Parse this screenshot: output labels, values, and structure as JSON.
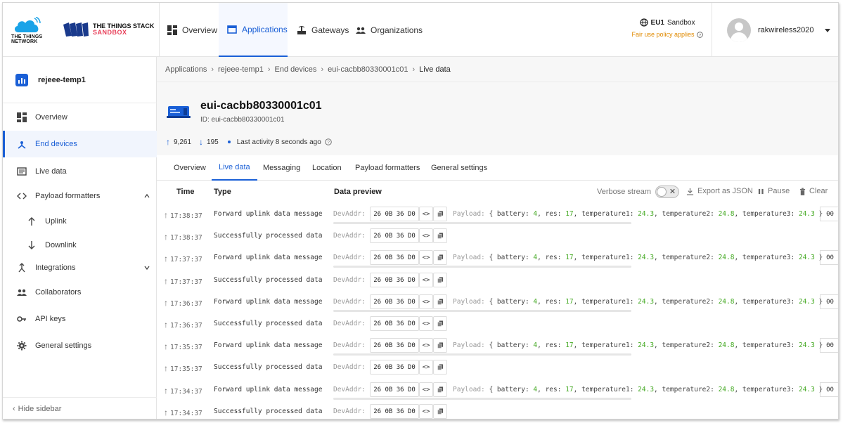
{
  "brand": {
    "ttn_text": "THE THINGS NETWORK",
    "stack_line1": "THE THINGS STACK",
    "stack_line2": "SANDBOX",
    "accent": "#1a5fd6",
    "stack_accent": "#e8405a"
  },
  "nav": [
    {
      "label": "Overview",
      "icon": "overview-icon",
      "active": false
    },
    {
      "label": "Applications",
      "icon": "applications-icon",
      "active": true
    },
    {
      "label": "Gateways",
      "icon": "gateway-icon",
      "active": false
    },
    {
      "label": "Organizations",
      "icon": "organizations-icon",
      "active": false
    }
  ],
  "sandbox": {
    "region": "EU1",
    "label": "Sandbox",
    "fair_use": "Fair use policy applies"
  },
  "user": {
    "name": "rakwireless2020"
  },
  "sidebar": {
    "app_name": "rejeee-temp1",
    "items": [
      {
        "label": "Overview",
        "icon": "overview-icon"
      },
      {
        "label": "End devices",
        "icon": "end-devices-icon",
        "active": true
      },
      {
        "label": "Live data",
        "icon": "live-data-icon"
      },
      {
        "label": "Payload formatters",
        "icon": "code-icon",
        "expanded": true
      },
      {
        "label": "Uplink",
        "icon": "arrow-up-icon"
      },
      {
        "label": "Downlink",
        "icon": "arrow-down-icon"
      },
      {
        "label": "Integrations",
        "icon": "integrations-icon"
      },
      {
        "label": "Collaborators",
        "icon": "collaborators-icon"
      },
      {
        "label": "API keys",
        "icon": "key-icon"
      },
      {
        "label": "General settings",
        "icon": "gear-icon"
      }
    ],
    "hide_label": "Hide sidebar"
  },
  "breadcrumb": [
    "Applications",
    "rejeee-temp1",
    "End devices",
    "eui-cacbb80330001c01",
    "Live data"
  ],
  "device": {
    "title": "eui-cacbb80330001c01",
    "id_label": "ID: eui-cacbb80330001c01",
    "uplinks": "9,261",
    "downlinks": "195",
    "last_activity": "Last activity 8 seconds ago"
  },
  "tabs": [
    "Overview",
    "Live data",
    "Messaging",
    "Location",
    "Payload formatters",
    "General settings"
  ],
  "active_tab": "Live data",
  "table": {
    "headers": {
      "time": "Time",
      "type": "Type",
      "preview": "Data preview"
    },
    "verbose_label": "Verbose stream",
    "export_label": "Export as JSON",
    "pause_label": "Pause",
    "clear_label": "Clear"
  },
  "rows": [
    {
      "time": "17:38:37",
      "type": "Forward uplink data message",
      "devaddr": "26 0B 36 D0",
      "payload": true
    },
    {
      "time": "17:38:37",
      "type": "Successfully processed data …",
      "devaddr": "26 0B 36 D0",
      "payload": false
    },
    {
      "time": "17:37:37",
      "type": "Forward uplink data message",
      "devaddr": "26 0B 36 D0",
      "payload": true
    },
    {
      "time": "17:37:37",
      "type": "Successfully processed data …",
      "devaddr": "26 0B 36 D0",
      "payload": false
    },
    {
      "time": "17:36:37",
      "type": "Forward uplink data message",
      "devaddr": "26 0B 36 D0",
      "payload": true
    },
    {
      "time": "17:36:37",
      "type": "Successfully processed data …",
      "devaddr": "26 0B 36 D0",
      "payload": false
    },
    {
      "time": "17:35:37",
      "type": "Forward uplink data message",
      "devaddr": "26 0B 36 D0",
      "payload": true
    },
    {
      "time": "17:35:37",
      "type": "Successfully processed data …",
      "devaddr": "26 0B 36 D0",
      "payload": false
    },
    {
      "time": "17:34:37",
      "type": "Forward uplink data message",
      "devaddr": "26 0B 36 D0",
      "payload": true
    },
    {
      "time": "17:34:37",
      "type": "Successfully processed data …",
      "devaddr": "26 0B 36 D0",
      "payload": false
    }
  ],
  "payload": {
    "devaddr_label": "DevAddr:",
    "label": "Payload:",
    "battery": "4",
    "res": "17",
    "temperature1": "24.3",
    "temperature2": "24.8",
    "temperature3": "24.3",
    "tail": "00"
  }
}
